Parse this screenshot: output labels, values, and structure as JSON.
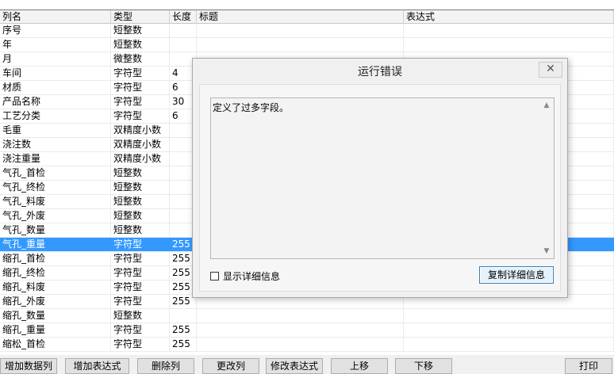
{
  "grid": {
    "columns": [
      "列名",
      "类型",
      "长度",
      "标题",
      "表达式"
    ],
    "rows": [
      [
        "序号",
        "短整数",
        "",
        "",
        ""
      ],
      [
        "年",
        "短整数",
        "",
        "",
        ""
      ],
      [
        "月",
        "微整数",
        "",
        "",
        ""
      ],
      [
        "车间",
        "字符型",
        "4",
        "",
        ""
      ],
      [
        "材质",
        "字符型",
        "6",
        "",
        ""
      ],
      [
        "产品名称",
        "字符型",
        "30",
        "",
        ""
      ],
      [
        "工艺分类",
        "字符型",
        "6",
        "",
        ""
      ],
      [
        "毛重",
        "双精度小数",
        "",
        "",
        ""
      ],
      [
        "浇注数",
        "双精度小数",
        "",
        "",
        ""
      ],
      [
        "浇注重量",
        "双精度小数",
        "",
        "",
        ""
      ],
      [
        "气孔_首检",
        "短整数",
        "",
        "",
        ""
      ],
      [
        "气孔_终检",
        "短整数",
        "",
        "",
        ""
      ],
      [
        "气孔_料废",
        "短整数",
        "",
        "",
        ""
      ],
      [
        "气孔_外废",
        "短整数",
        "",
        "",
        ""
      ],
      [
        "气孔_数量",
        "短整数",
        "",
        "",
        ""
      ],
      [
        "气孔_重量",
        "字符型",
        "255",
        "",
        ""
      ],
      [
        "缩孔_首检",
        "字符型",
        "255",
        "",
        ""
      ],
      [
        "缩孔_终检",
        "字符型",
        "255",
        "",
        ""
      ],
      [
        "缩孔_料废",
        "字符型",
        "255",
        "",
        ""
      ],
      [
        "缩孔_外废",
        "字符型",
        "255",
        "",
        ""
      ],
      [
        "缩孔_数量",
        "短整数",
        "",
        "",
        ""
      ],
      [
        "缩孔_重量",
        "字符型",
        "255",
        "",
        ""
      ],
      [
        "缩松_首检",
        "字符型",
        "255",
        "",
        ""
      ]
    ],
    "selected_row": 15
  },
  "buttons": [
    "增加数据列",
    "增加表达式",
    "删除列",
    "更改列",
    "修改表达式",
    "上移",
    "下移",
    "打印"
  ],
  "dialog": {
    "title": "运行错误",
    "close": "✕",
    "message": "定义了过多字段。",
    "show_details_label": "显示详细信息",
    "show_details_checked": false,
    "copy_button": "复制详细信息"
  },
  "colors": {
    "selection": "#3399ff",
    "header_bg": "#f3f3f3"
  }
}
